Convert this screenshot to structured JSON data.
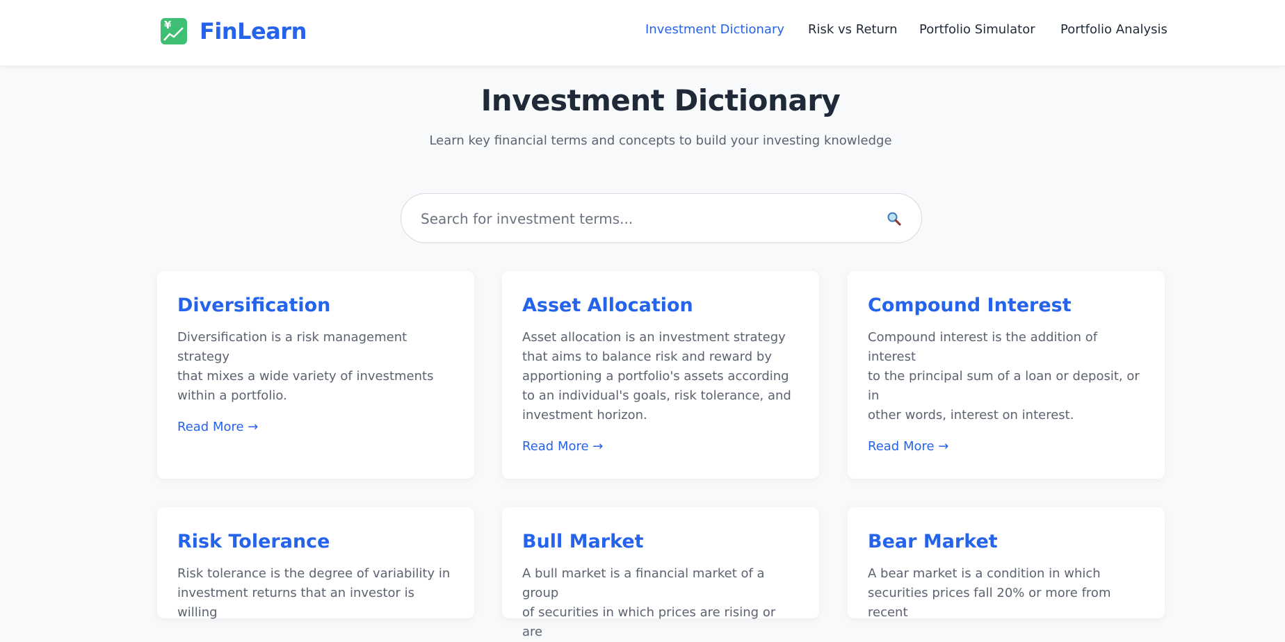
{
  "brand": {
    "name": "FinLearn",
    "icon": "chart-icon",
    "accent": "#2563eb"
  },
  "nav": {
    "items": [
      {
        "label": "Investment Dictionary",
        "active": true
      },
      {
        "label": "Risk vs Return",
        "active": false
      },
      {
        "label": "Portfolio Simulator",
        "active": false
      },
      {
        "label": "Portfolio Analysis",
        "active": false
      }
    ]
  },
  "header": {
    "title": "Investment Dictionary",
    "subtitle": "Learn key financial terms and concepts to build your investing knowledge"
  },
  "search": {
    "placeholder": "Search for investment terms...",
    "value": "",
    "icon": "search-icon"
  },
  "cards": [
    {
      "title": "Diversification",
      "desc_lines": [
        "Diversification is a risk management strategy",
        "that mixes a wide variety of investments",
        "within a portfolio."
      ],
      "link": "Read More →"
    },
    {
      "title": "Asset Allocation",
      "desc_lines": [
        "Asset allocation is an investment strategy",
        "that aims to balance risk and reward by",
        "apportioning a portfolio's assets according",
        "to an individual's goals, risk tolerance, and",
        "investment horizon."
      ],
      "link": "Read More →"
    },
    {
      "title": "Compound Interest",
      "desc_lines": [
        "Compound interest is the addition of interest",
        "to the principal sum of a loan or deposit, or in",
        "other words, interest on interest."
      ],
      "link": "Read More →"
    },
    {
      "title": "Risk Tolerance",
      "desc_lines": [
        "Risk tolerance is the degree of variability in",
        "investment returns that an investor is willing"
      ],
      "link": ""
    },
    {
      "title": "Bull Market",
      "desc_lines": [
        "A bull market is a financial market of a group",
        "of securities in which prices are rising or are"
      ],
      "link": ""
    },
    {
      "title": "Bear Market",
      "desc_lines": [
        "A bear market is a condition in which",
        "securities prices fall 20% or more from recent"
      ],
      "link": ""
    }
  ]
}
